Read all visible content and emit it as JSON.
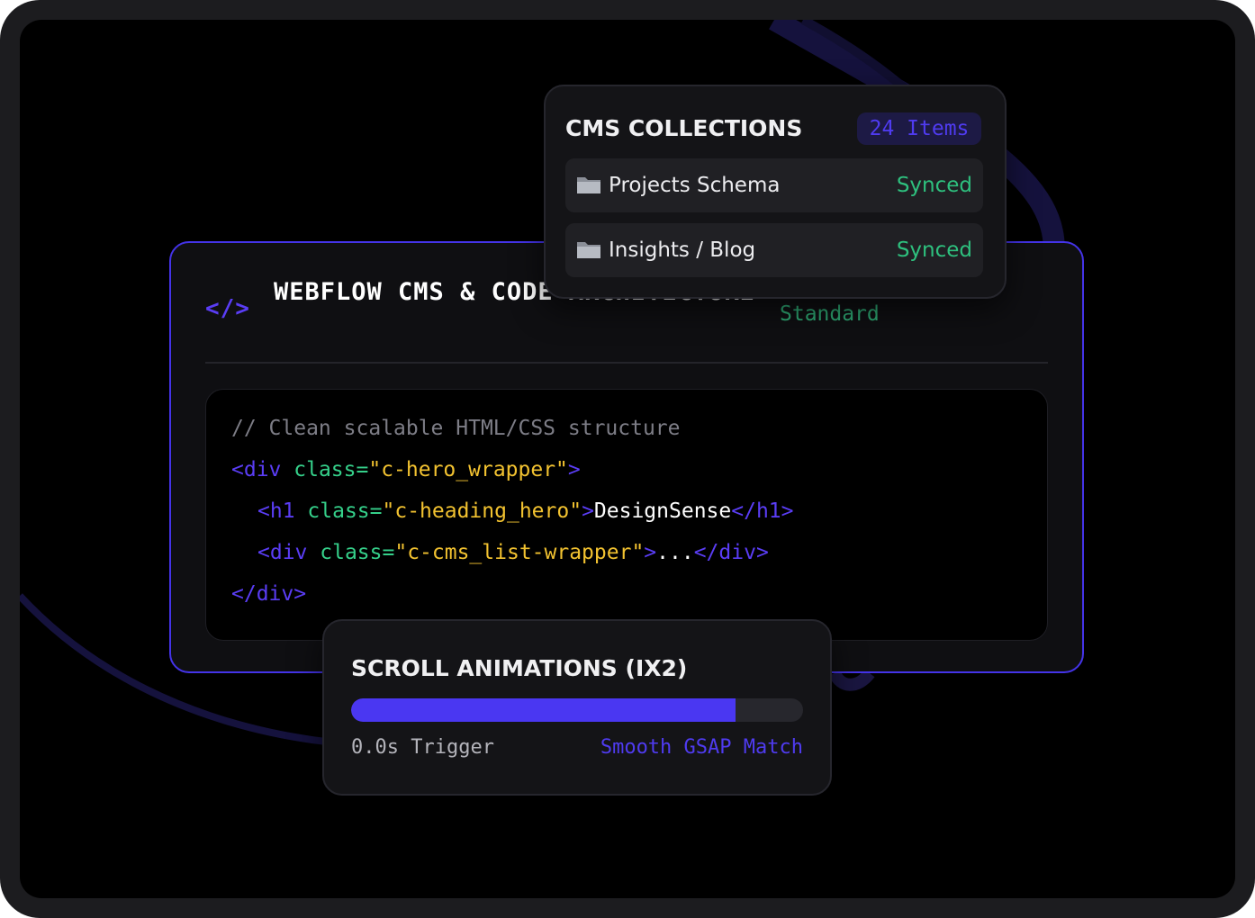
{
  "main_card": {
    "icon": "code-icon",
    "tag_symbol": "</>",
    "title": "WEBFLOW CMS & CODE ARCHITECTURE",
    "status": "Standard"
  },
  "code": {
    "comment": "// Clean scalable HTML/CSS structure",
    "line1": {
      "open": "<div",
      "attr": "class=",
      "value": "\"c-hero_wrapper\"",
      "close": ">"
    },
    "line2": {
      "open": "<h1",
      "attr": "class=",
      "value": "\"c-heading_hero\"",
      "close": ">",
      "text": "DesignSense",
      "end": "</h1>"
    },
    "line3": {
      "open": "<div",
      "attr": "class=",
      "value": "\"c-cms_list-wrapper\"",
      "close": ">",
      "text": "...",
      "end": "</div>"
    },
    "line4": {
      "end": "</div>"
    }
  },
  "cms": {
    "title": "CMS COLLECTIONS",
    "count": "24 Items",
    "rows": [
      {
        "icon": "folder-icon",
        "name": "Projects Schema",
        "status": "Synced"
      },
      {
        "icon": "folder-icon",
        "name": "Insights / Blog",
        "status": "Synced"
      }
    ]
  },
  "scroll": {
    "title": "SCROLL ANIMATIONS (IX2)",
    "progress": 0.85,
    "left_label": "0.0s Trigger",
    "right_label": "Smooth GSAP Match"
  },
  "colors": {
    "accent": "#4a37f2",
    "success": "#2ec07e",
    "string": "#f2c230",
    "background": "#000000"
  }
}
